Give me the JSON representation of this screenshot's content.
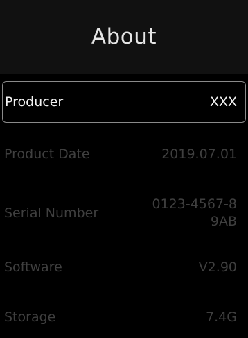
{
  "header": {
    "title": "About"
  },
  "items": [
    {
      "label": "Producer",
      "value": "XXX",
      "selected": true
    },
    {
      "label": "Product Date",
      "value": "2019.07.01",
      "selected": false
    },
    {
      "label": "Serial Number",
      "value": "0123-4567-89AB",
      "selected": false
    },
    {
      "label": "Software",
      "value": "V2.90",
      "selected": false
    },
    {
      "label": "Storage",
      "value": "7.4G",
      "selected": false
    }
  ],
  "colors": {
    "background": "#000000",
    "header_background": "#111111",
    "selected_text": "#f2f2f2",
    "dim_text": "#3f3f3f",
    "selection_border": "#8a8a8a"
  }
}
